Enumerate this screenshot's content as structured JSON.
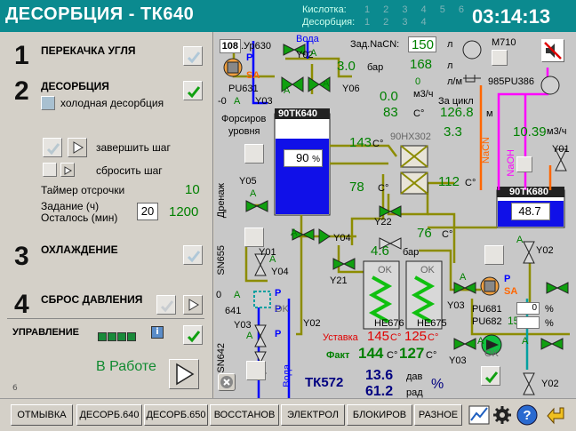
{
  "header": {
    "title": "ДЕСОРБЦИЯ - ТК640",
    "acid_label": "Кислотка:",
    "acid_nums": "1 2 3 4 5 6",
    "desorb_label": "Десорбция:",
    "desorb_nums": "1 2 3 4",
    "clock": "03:14:13"
  },
  "steps": {
    "s1_num": "1",
    "s1_label": "ПЕРЕКАЧКА УГЛЯ",
    "s2_num": "2",
    "s2_label": "ДЕСОРБЦИЯ",
    "cold_label": "холодная десорбция",
    "finish_label": "завершить шаг",
    "reset_label": "сбросить шаг",
    "timer_label": "Таймер отсрочки",
    "timer_value": "10",
    "task_label": "Задание (ч)",
    "task_value": "20",
    "left_label": "Осталось (мин)",
    "left_value": "1200",
    "s3_num": "3",
    "s3_label": "ОХЛАЖДЕНИЕ",
    "s4_num": "4",
    "s4_label": "СБРОС ДАВЛЕНИЯ",
    "control_label": "УПРАВЛЕНИЕ",
    "info_icon": "i",
    "status": "В Работе",
    "page_no": "6"
  },
  "diagram": {
    "ur630_val": "108",
    "ur630_label": ".Ур630",
    "p_letter": "P",
    "sa_letter": "SA",
    "voda_top": "Вода",
    "y02": "Y02",
    "y03": "Y03",
    "y06": "Y06",
    "y05": "Y05",
    "y01": "Y01",
    "y04": "Y04",
    "y21": "Y21",
    "y22": "Y22",
    "pu631": "PU631",
    "pu631_val": "-0",
    "a_letter": "A",
    "flow_val": "3.0",
    "bar": "бар",
    "zad_nacn_label": "Зад.NaCN:",
    "zad_nacn_val": "150",
    "l": "л",
    "m710": "M710",
    "flow2_val": "168",
    "l2": "л",
    "zero_val": "0",
    "l_m": "л/м",
    "v1": "0.0",
    "m3h": "м3/ч",
    "v2": "83",
    "deg_c": "С°",
    "za_cikl": "За цикл",
    "za_cikl_val": "126.8",
    "m_unit": "м",
    "pu386": "985PU386",
    "forsirov": "Форсиров",
    "urovnya": "уровня",
    "tank640": "90ТК640",
    "tank640_val": "90",
    "pct": "%",
    "hx_label": "90НХ302",
    "t143": "143",
    "v3": "3.3",
    "v4": "10.39",
    "m3h2": "м3/ч",
    "nacn": "NaCN",
    "naoh": "NaOH",
    "t78": "78",
    "t112": "112",
    "tank680": "90ТК680",
    "tank680_val": "48.7",
    "drenazh": "Дренаж",
    "t76": "76",
    "t46": "4.6",
    "sn655": "SN655",
    "sn642": "SN642",
    "v641_a": "0",
    "v641": "641",
    "ok": "OK",
    "he676": "НЕ676",
    "he675": "НЕ675",
    "ustavka": "Уставка",
    "ust1": "145",
    "ust2": "125",
    "fakt": "Факт",
    "fakt1": "144",
    "fakt2": "127",
    "pu681": "PU681",
    "pu681_val": "0",
    "pu682": "PU682",
    "pu682_val": "15",
    "voda_bot": "Вода",
    "tk572": "ТК572",
    "dav_val": "13.6",
    "dav": "дав",
    "rad_val": "61.2",
    "rad": "рад",
    "pct2": "%"
  },
  "toolbar": {
    "b1": "ОТМЫВКА",
    "b2": "ДЕСОРБ.640",
    "b3": "ДЕСОРБ.650",
    "b4": "ВОССТАНОВ",
    "b5": "ЭЛЕКТРОЛ",
    "b6": "БЛОКИРОВ",
    "b7": "РАЗНОЕ"
  },
  "colors": {
    "header": "#0b8a8f",
    "pipe_olive": "#8c8c00",
    "pipe_red": "#cc0000",
    "pipe_blue": "#0000ff",
    "pipe_orange": "#ff6600",
    "pipe_magenta": "#ff00ff",
    "tank_fill": "#0000ff",
    "value_green": "#008000"
  }
}
